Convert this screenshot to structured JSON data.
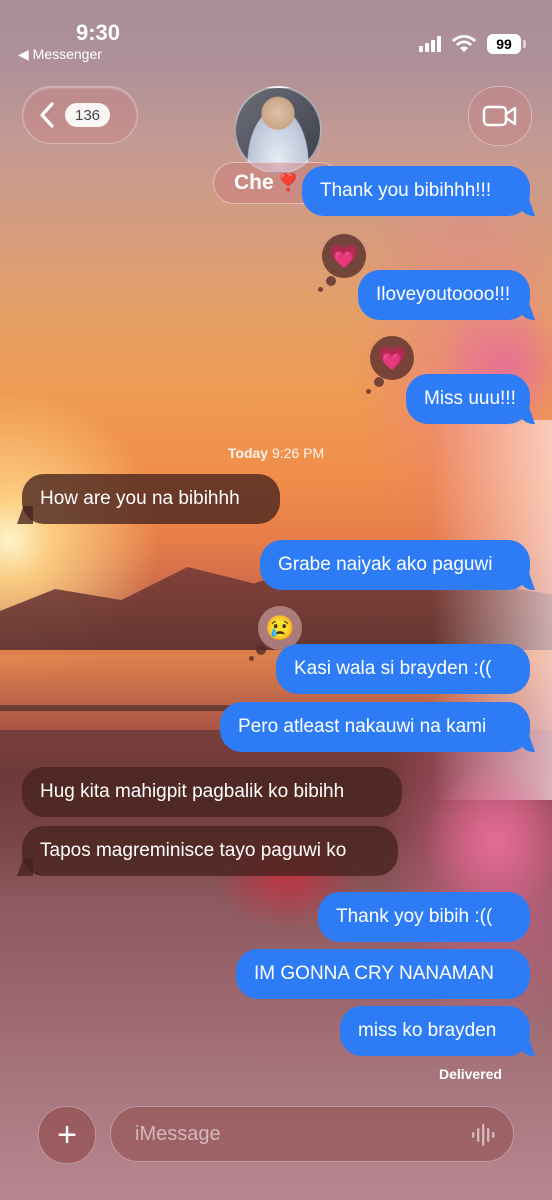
{
  "status_bar": {
    "time": "9:30",
    "back_app": "◀ Messenger",
    "battery": "99"
  },
  "header": {
    "unread_count": "136",
    "contact_name": "Che",
    "contact_emoji": "❣️"
  },
  "messages": {
    "m1": "Thank you bibihhh!!!",
    "m2": "Iloveyoutoooo!!!",
    "m3": "Miss uuu!!!",
    "timestamp_day": "Today",
    "timestamp_time": "9:26 PM",
    "m4": "How are you na bibihhh",
    "m5": "Grabe naiyak ako paguwi",
    "m6": "Kasi wala si brayden :((",
    "m7": "Pero atleast nakauwi na kami",
    "m8": "Hug kita mahigpit pagbalik ko bibihh",
    "m9": "Tapos magreminisce tayo paguwi ko",
    "m10": "Thank yoy bibih :((",
    "m11": "IM GONNA CRY NANAMAN",
    "m12": "miss ko brayden",
    "delivered": "Delivered"
  },
  "reactions": {
    "heart": "💗",
    "cry": "😢"
  },
  "composer": {
    "plus": "+",
    "placeholder": "iMessage"
  },
  "colors": {
    "sent_bubble": "#2d7cf6",
    "received_bubble": "#46231e"
  }
}
